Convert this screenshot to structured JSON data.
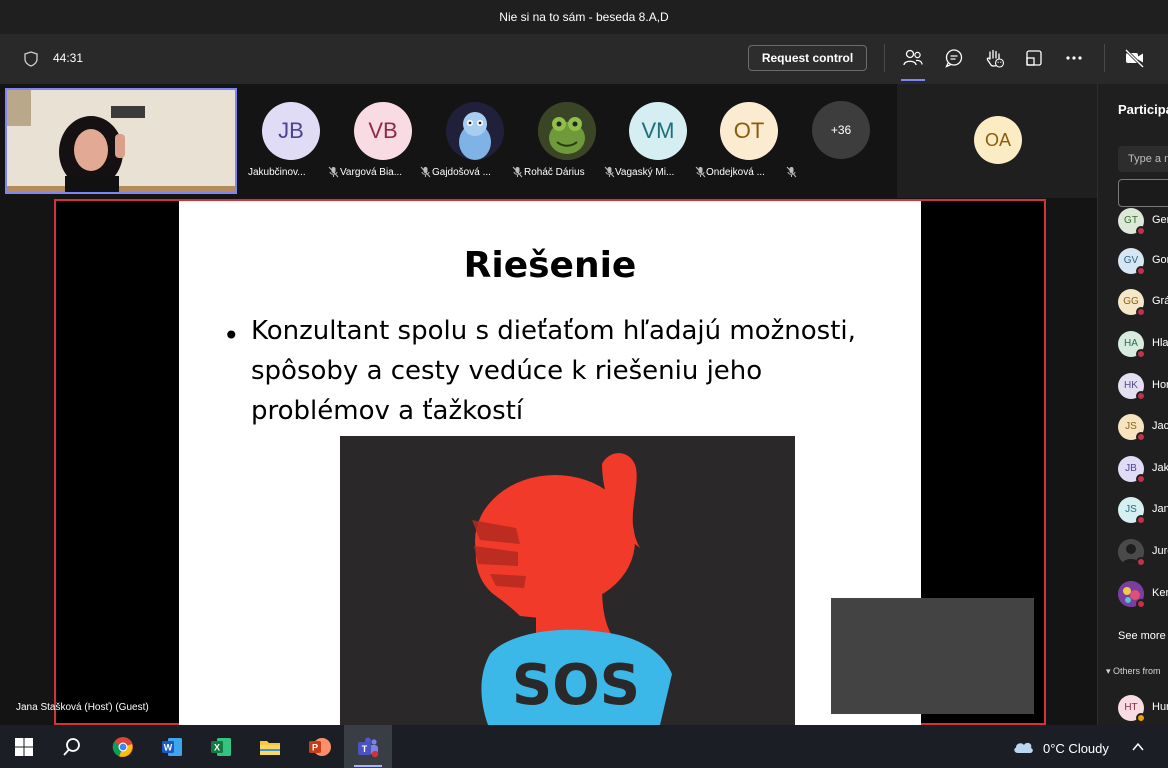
{
  "window": {
    "title": "Nie si na to sám - beseda 8.A,D"
  },
  "toolbar": {
    "timer": "44:31",
    "request_control_label": "Request control",
    "icons": [
      "shield-icon",
      "people-icon",
      "chat-icon",
      "raise-hand-icon",
      "room-icon",
      "more-icon",
      "camera-off-icon"
    ]
  },
  "participants_strip": {
    "tiles": [
      {
        "initials": "JB",
        "name": "Jakubčinov...",
        "bg": "#e0dcf6",
        "fg": "#4c4493"
      },
      {
        "initials": "VB",
        "name": "Vargová Bia...",
        "bg": "#f9dbe3",
        "fg": "#8f2b4a"
      },
      {
        "initials": "",
        "name": "Gajdošová ...",
        "bg": "#1a1a2e",
        "fg": "#ffffff"
      },
      {
        "initials": "",
        "name": "Roháč Dárius",
        "bg": "#3f4a2a",
        "fg": "#ffffff"
      },
      {
        "initials": "VM",
        "name": "Vagaský Mi...",
        "bg": "#d5eef1",
        "fg": "#1f6f7a"
      },
      {
        "initials": "OT",
        "name": "Ondejková ...",
        "bg": "#fbecd1",
        "fg": "#8a5d0c"
      }
    ],
    "overflow_count": "+36",
    "spotlight_initials": "OA"
  },
  "presenter": {
    "label": "Jana Stašková (Hosť) (Guest)"
  },
  "slide": {
    "title": "Riešenie",
    "bullet": "Konzultant spolu s dieťaťom hľadajú možnosti, spôsoby a cesty vedúce k riešeniu jeho problémov a ťažkostí",
    "image_text": "SOS"
  },
  "panel": {
    "title": "Participants",
    "search_placeholder": "Type a name",
    "people": [
      {
        "initials": "GT",
        "name": "Gen",
        "bg": "#dbe9d6",
        "fg": "#3c6b32"
      },
      {
        "initials": "GV",
        "name": "Gor",
        "bg": "#d6e6f2",
        "fg": "#2f5f84"
      },
      {
        "initials": "GG",
        "name": "Grá",
        "bg": "#f6e7c8",
        "fg": "#8a6412"
      },
      {
        "initials": "HA",
        "name": "Hla",
        "bg": "#d7ecdf",
        "fg": "#2e6b48"
      },
      {
        "initials": "HK",
        "name": "Hor",
        "bg": "#e4e0f4",
        "fg": "#514a8a"
      },
      {
        "initials": "JS",
        "name": "Jacl",
        "bg": "#f5e4bf",
        "fg": "#8a6412"
      },
      {
        "initials": "JB",
        "name": "Jakı",
        "bg": "#e0dcf6",
        "fg": "#4c4493"
      },
      {
        "initials": "JS",
        "name": "Jan",
        "bg": "#d6eff0",
        "fg": "#1f6f7a"
      },
      {
        "initials": "",
        "name": "Jurc",
        "bg": "#3a3a3a",
        "fg": "#ffffff"
      },
      {
        "initials": "",
        "name": "Ker",
        "bg": "#6b3a8a",
        "fg": "#ffffff"
      }
    ],
    "see_more": "See more",
    "others_label": "Others from",
    "other_person": {
      "initials": "HT",
      "name": "Hun",
      "bg": "#f9dbe3",
      "fg": "#8f2b4a"
    }
  },
  "taskbar": {
    "apps": [
      "start-icon",
      "search-icon",
      "chrome-icon",
      "word-icon",
      "excel-icon",
      "file-explorer-icon",
      "powerpoint-icon",
      "teams-icon"
    ],
    "weather": "0°C  Cloudy"
  },
  "colors": {
    "accent": "#7f85f5",
    "share_border": "#d13438",
    "toolbar_bg": "#292929"
  }
}
